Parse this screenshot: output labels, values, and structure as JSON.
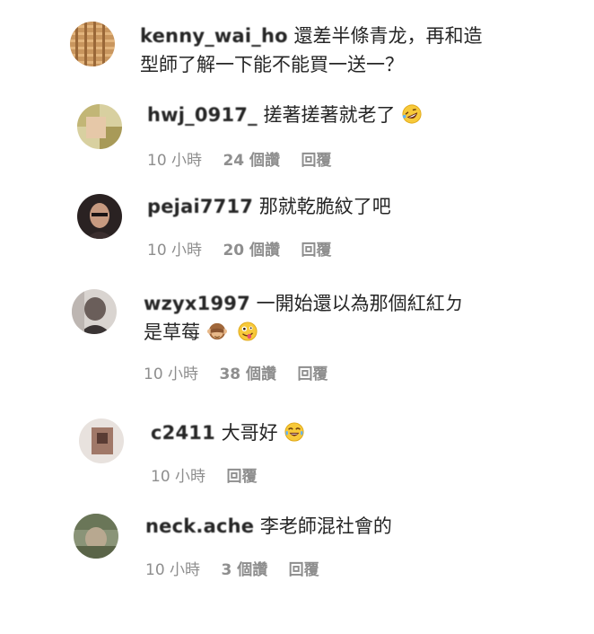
{
  "comments": [
    {
      "username": "kenny_wai_ho",
      "text_line1": "還差半條青龙，再和造",
      "text_line2": "型師了解一下能不能買一送一？",
      "emoji": "",
      "avatar_color": "#c08a52"
    },
    {
      "username": "hwj_0917_",
      "text_line1": "搓著搓著就老了",
      "emoji": "rofl-emoji",
      "time": "10 小時",
      "likes": "24 個讚",
      "reply": "回覆",
      "avatar_color": "#b8b060"
    },
    {
      "username": "pejai7717",
      "text_line1": "那就乾脆紋了吧",
      "emoji": "",
      "time": "10 小時",
      "likes": "20 個讚",
      "reply": "回覆",
      "avatar_color": "#3a3030"
    },
    {
      "username": "wzyx1997",
      "text_line1": "一開始還以為那個紅紅ㄉ",
      "text_line2": "是草莓",
      "emoji": "see-no-evil-monkey-emoji zany-face-emoji",
      "time": "10 小時",
      "likes": "38 個讚",
      "reply": "回覆",
      "avatar_color": "#8a8080"
    },
    {
      "username": "c2411",
      "text_line1": "大哥好",
      "emoji": "tears-of-joy-emoji",
      "time": "10 小時",
      "reply": "回覆",
      "avatar_color": "#a07868"
    },
    {
      "username": "neck.ache",
      "text_line1": "李老師混社會的",
      "emoji": "",
      "time": "10 小時",
      "likes": "3 個讚",
      "reply": "回覆",
      "avatar_color": "#6f7f62"
    }
  ]
}
